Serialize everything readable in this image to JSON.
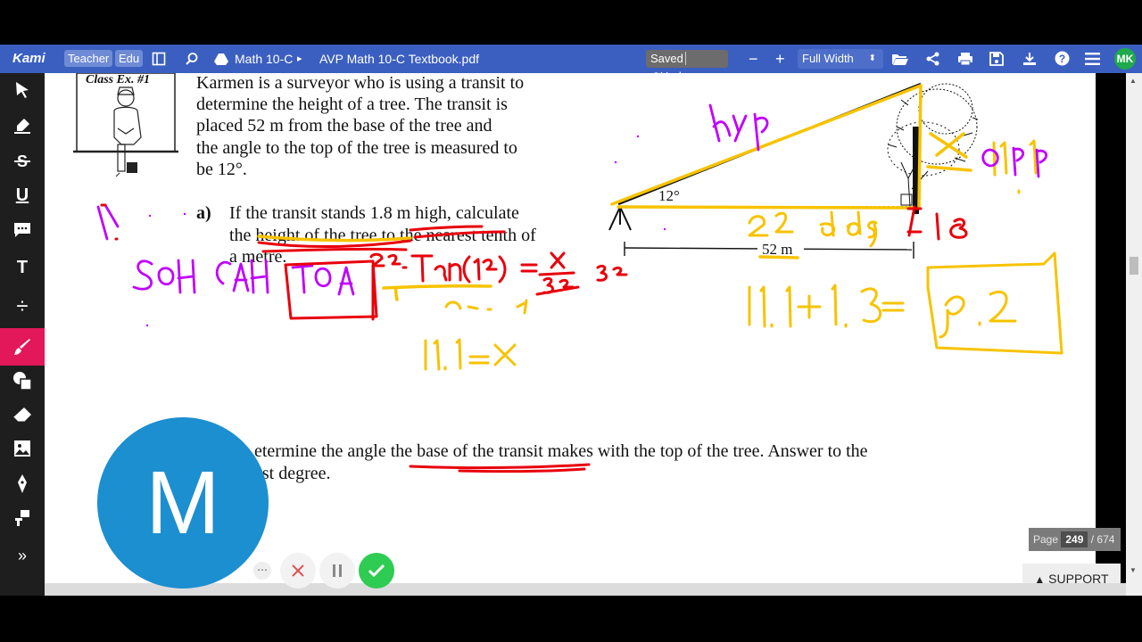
{
  "toolbar": {
    "logo": "Kami",
    "role_teacher": "Teacher",
    "role_edu": "Edu",
    "folder": "Math 10-C",
    "breadcrumb_sep": "▸",
    "filename": "AVP Math 10-C Textbook.pdf",
    "saved": "Saved",
    "undo": "Undo",
    "zoom_minus": "−",
    "zoom_plus": "+",
    "zoom_mode": "Full Width",
    "avatar_initials": "MK"
  },
  "sidebar": {
    "items": [
      "select-tool",
      "highlight-tool",
      "strikethrough-tool",
      "underline-tool",
      "comment-tool",
      "text-tool",
      "equation-tool",
      "drawing-tool",
      "shapes-tool",
      "eraser-tool",
      "image-tool",
      "signature-tool",
      "add-page-tool",
      "expand-toolbar"
    ],
    "tool_labels": {
      "underline": "U",
      "text": "T",
      "equation": "÷"
    }
  },
  "drawing_options": {
    "stroke_size": "1",
    "colors": [
      "#f7c300",
      "#c000ff",
      "#e8000b"
    ]
  },
  "document": {
    "class_ex": "Class Ex. #1",
    "problem_lines": [
      "Karmen is a surveyor who is using a transit to",
      "determine the height of a tree.  The transit is",
      "placed  52 m  from the base of the tree and",
      "the angle to the top of the tree is measured to",
      "be  12°."
    ],
    "part_a_label": "a)",
    "part_a_lines": [
      "If the transit stands  1.8 m  high, calculate",
      "the height of the tree to the nearest tenth of",
      "a metre."
    ],
    "diagram_angle": "12°",
    "diagram_distance": "52 m",
    "part_b_lines": [
      "etermine the angle the base of the transit makes with the top of the tree.  Answer to the",
      "est degree."
    ]
  },
  "annotations": {
    "hyp": "hyp",
    "opp": "opp",
    "opp_value": "11.1",
    "adj": "52 adj",
    "transit_height": "1.8",
    "soh": "SOH CAH",
    "toa": "TOA",
    "equation_left": "52 · Tan(12) =",
    "fraction_num": "x",
    "fraction_den": "52",
    "fraction_mult": "52",
    "calc": "calc",
    "result": "11.1=x",
    "sum": "11.1+1.8=",
    "final_answer": "12.9",
    "part_marker": "1."
  },
  "page_indicator": {
    "label": "Page",
    "current": "249",
    "total": "/ 674"
  },
  "support": "SUPPORT",
  "recorder": {
    "initial": "M"
  },
  "colors": {
    "toolbar": "#3b5fc0",
    "sidebar": "#1e1e1e",
    "annot_yellow": "#f7c300",
    "annot_magenta": "#c000ff",
    "annot_red": "#e8000b"
  }
}
